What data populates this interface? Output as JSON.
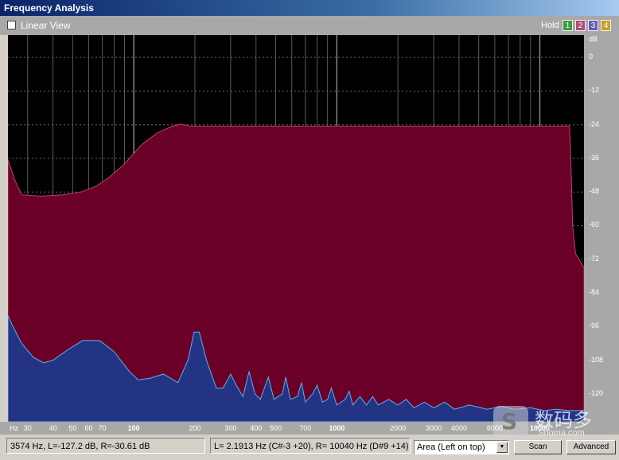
{
  "window": {
    "title": "Frequency Analysis"
  },
  "toolbar": {
    "linear_view_label": "Linear View",
    "linear_view_checked": false,
    "hold_label": "Hold",
    "hold_buttons": [
      {
        "label": "1",
        "color": "#3d9a3d"
      },
      {
        "label": "2",
        "color": "#b04a7a"
      },
      {
        "label": "3",
        "color": "#6a5ab4"
      },
      {
        "label": "4",
        "color": "#c8a020"
      }
    ]
  },
  "chart_data": {
    "type": "area",
    "x_scale": "log",
    "y_unit": "dB",
    "xlim": [
      24,
      16500
    ],
    "ylim": [
      -130,
      8
    ],
    "x_unit_label": "Hz",
    "x_ticks": [
      {
        "value": 30,
        "label": "30"
      },
      {
        "value": 40,
        "label": "40"
      },
      {
        "value": 50,
        "label": "50"
      },
      {
        "value": 60,
        "label": "60"
      },
      {
        "value": 70,
        "label": "70"
      },
      {
        "value": 100,
        "label": "100"
      },
      {
        "value": 200,
        "label": "200"
      },
      {
        "value": 300,
        "label": "300"
      },
      {
        "value": 400,
        "label": "400"
      },
      {
        "value": 500,
        "label": "500"
      },
      {
        "value": 700,
        "label": "700"
      },
      {
        "value": 1000,
        "label": "1000"
      },
      {
        "value": 2000,
        "label": "2000"
      },
      {
        "value": 3000,
        "label": "3000"
      },
      {
        "value": 4000,
        "label": "4000"
      },
      {
        "value": 6000,
        "label": "6000"
      },
      {
        "value": 10000,
        "label": "10000"
      }
    ],
    "y_ticks": [
      {
        "value": 0,
        "label": "0"
      },
      {
        "value": -12,
        "label": "-12"
      },
      {
        "value": -24,
        "label": "-24"
      },
      {
        "value": -36,
        "label": "-36"
      },
      {
        "value": -48,
        "label": "-48"
      },
      {
        "value": -60,
        "label": "-60"
      },
      {
        "value": -72,
        "label": "-72"
      },
      {
        "value": -84,
        "label": "-84"
      },
      {
        "value": -96,
        "label": "-96"
      },
      {
        "value": -108,
        "label": "-108"
      },
      {
        "value": -120,
        "label": "-120"
      }
    ],
    "y_axis_title": "dB",
    "grid": true,
    "series": [
      {
        "color": "#6a0028",
        "points": [
          [
            24,
            -36.5
          ],
          [
            26,
            -44
          ],
          [
            28,
            -49
          ],
          [
            35,
            -49.5
          ],
          [
            45,
            -49
          ],
          [
            55,
            -48
          ],
          [
            65,
            -46
          ],
          [
            75,
            -43
          ],
          [
            90,
            -38
          ],
          [
            110,
            -31
          ],
          [
            130,
            -27
          ],
          [
            155,
            -24.5
          ],
          [
            170,
            -23.8
          ],
          [
            190,
            -24.5
          ],
          [
            300,
            -24.5
          ],
          [
            1000,
            -24.5
          ],
          [
            10000,
            -24.5
          ],
          [
            12000,
            -24.5
          ],
          [
            14000,
            -24.4
          ],
          [
            14200,
            -36
          ],
          [
            14500,
            -60
          ],
          [
            15000,
            -70
          ],
          [
            16500,
            -75
          ]
        ]
      },
      {
        "color": "#243485",
        "points": [
          [
            24,
            -92
          ],
          [
            25,
            -95
          ],
          [
            28,
            -102
          ],
          [
            32,
            -107
          ],
          [
            36,
            -109
          ],
          [
            40,
            -108
          ],
          [
            48,
            -104
          ],
          [
            56,
            -101
          ],
          [
            68,
            -101
          ],
          [
            80,
            -105
          ],
          [
            95,
            -112
          ],
          [
            105,
            -115
          ],
          [
            120,
            -114.5
          ],
          [
            140,
            -113
          ],
          [
            165,
            -116
          ],
          [
            185,
            -108
          ],
          [
            198,
            -98
          ],
          [
            210,
            -98
          ],
          [
            228,
            -108
          ],
          [
            255,
            -118
          ],
          [
            275,
            -118
          ],
          [
            300,
            -113
          ],
          [
            320,
            -117
          ],
          [
            345,
            -121
          ],
          [
            370,
            -112
          ],
          [
            395,
            -120
          ],
          [
            420,
            -122
          ],
          [
            460,
            -114
          ],
          [
            490,
            -122
          ],
          [
            540,
            -120
          ],
          [
            560,
            -114
          ],
          [
            590,
            -122
          ],
          [
            640,
            -121
          ],
          [
            670,
            -116
          ],
          [
            700,
            -123
          ],
          [
            760,
            -120
          ],
          [
            800,
            -117
          ],
          [
            850,
            -123
          ],
          [
            900,
            -122
          ],
          [
            940,
            -118
          ],
          [
            1000,
            -124
          ],
          [
            1100,
            -122
          ],
          [
            1150,
            -119
          ],
          [
            1200,
            -124
          ],
          [
            1300,
            -121
          ],
          [
            1400,
            -124
          ],
          [
            1500,
            -121
          ],
          [
            1600,
            -124
          ],
          [
            1800,
            -122
          ],
          [
            2000,
            -124
          ],
          [
            2200,
            -122
          ],
          [
            2400,
            -125
          ],
          [
            2700,
            -123
          ],
          [
            3000,
            -125
          ],
          [
            3400,
            -123
          ],
          [
            3800,
            -125.5
          ],
          [
            4500,
            -124
          ],
          [
            5500,
            -125.5
          ],
          [
            6500,
            -124.5
          ],
          [
            7500,
            -125.5
          ],
          [
            9000,
            -125
          ],
          [
            10500,
            -126
          ],
          [
            12000,
            -125.5
          ],
          [
            14000,
            -126
          ],
          [
            16500,
            -126
          ]
        ]
      }
    ]
  },
  "status": {
    "cursor_readout": "3574 Hz, L=-127.2 dB, R=-30.61 dB",
    "peak_readout": "L= 2.1913 Hz (C#-3 +20), R=  10040 Hz (D#9 +14)",
    "view_mode": "Area (Left on top)",
    "scan_label": "Scan",
    "advanced_label": "Advanced"
  },
  "watermark": {
    "site_chinese": "数码多",
    "site_url": "Sooma.com",
    "logo_letter": "S"
  }
}
